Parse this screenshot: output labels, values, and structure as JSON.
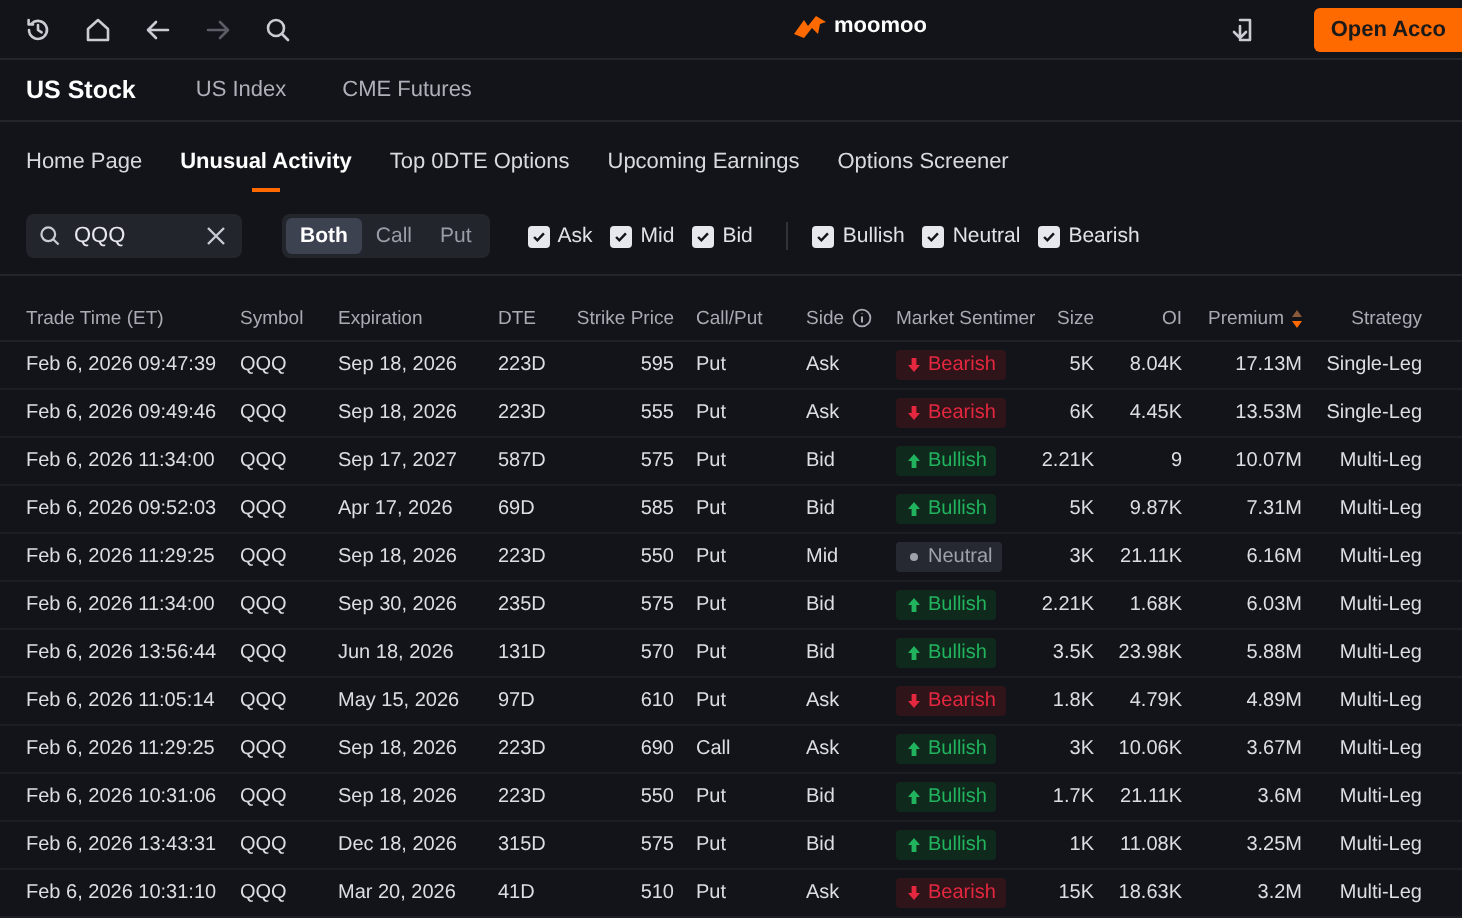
{
  "top_bar": {
    "logo": "moomoo",
    "open_account_button": "Open Acco"
  },
  "market_tabs": [
    {
      "label": "US Stock",
      "selected": true
    },
    {
      "label": "US Index",
      "selected": false
    },
    {
      "label": "CME Futures",
      "selected": false
    }
  ],
  "sub_tabs": [
    {
      "label": "Home Page",
      "selected": false
    },
    {
      "label": "Unusual Activity",
      "selected": true
    },
    {
      "label": "Top 0DTE Options",
      "selected": false
    },
    {
      "label": "Upcoming Earnings",
      "selected": false
    },
    {
      "label": "Options Screener",
      "selected": false
    }
  ],
  "search": {
    "value": "QQQ"
  },
  "type_segment": [
    {
      "label": "Both",
      "selected": true
    },
    {
      "label": "Call",
      "selected": false
    },
    {
      "label": "Put",
      "selected": false
    }
  ],
  "side_filters": [
    {
      "label": "Ask",
      "checked": true
    },
    {
      "label": "Mid",
      "checked": true
    },
    {
      "label": "Bid",
      "checked": true
    }
  ],
  "sentiment_filters": [
    {
      "label": "Bullish",
      "checked": true
    },
    {
      "label": "Neutral",
      "checked": true
    },
    {
      "label": "Bearish",
      "checked": true
    }
  ],
  "table": {
    "columns": [
      "Trade Time (ET)",
      "Symbol",
      "Expiration",
      "DTE",
      "Strike Price",
      "Call/Put",
      "Side",
      "Market Sentimer",
      "Size",
      "OI",
      "Premium",
      "Strategy"
    ],
    "rows": [
      {
        "time": "Feb 6, 2026 09:47:39",
        "symbol": "QQQ",
        "expiration": "Sep 18, 2026",
        "dte": "223D",
        "strike": "595",
        "type": "Put",
        "side": "Ask",
        "sentiment": {
          "kind": "bearish",
          "label": "Bearish"
        },
        "size": "5K",
        "oi": "8.04K",
        "premium": "17.13M",
        "strategy": "Single-Leg"
      },
      {
        "time": "Feb 6, 2026 09:49:46",
        "symbol": "QQQ",
        "expiration": "Sep 18, 2026",
        "dte": "223D",
        "strike": "555",
        "type": "Put",
        "side": "Ask",
        "sentiment": {
          "kind": "bearish",
          "label": "Bearish"
        },
        "size": "6K",
        "oi": "4.45K",
        "premium": "13.53M",
        "strategy": "Single-Leg"
      },
      {
        "time": "Feb 6, 2026 11:34:00",
        "symbol": "QQQ",
        "expiration": "Sep 17, 2027",
        "dte": "587D",
        "strike": "575",
        "type": "Put",
        "side": "Bid",
        "sentiment": {
          "kind": "bullish",
          "label": "Bullish"
        },
        "size": "2.21K",
        "oi": "9",
        "premium": "10.07M",
        "strategy": "Multi-Leg"
      },
      {
        "time": "Feb 6, 2026 09:52:03",
        "symbol": "QQQ",
        "expiration": "Apr 17, 2026",
        "dte": "69D",
        "strike": "585",
        "type": "Put",
        "side": "Bid",
        "sentiment": {
          "kind": "bullish",
          "label": "Bullish"
        },
        "size": "5K",
        "oi": "9.87K",
        "premium": "7.31M",
        "strategy": "Multi-Leg"
      },
      {
        "time": "Feb 6, 2026 11:29:25",
        "symbol": "QQQ",
        "expiration": "Sep 18, 2026",
        "dte": "223D",
        "strike": "550",
        "type": "Put",
        "side": "Mid",
        "sentiment": {
          "kind": "neutral",
          "label": "Neutral"
        },
        "size": "3K",
        "oi": "21.11K",
        "premium": "6.16M",
        "strategy": "Multi-Leg"
      },
      {
        "time": "Feb 6, 2026 11:34:00",
        "symbol": "QQQ",
        "expiration": "Sep 30, 2026",
        "dte": "235D",
        "strike": "575",
        "type": "Put",
        "side": "Bid",
        "sentiment": {
          "kind": "bullish",
          "label": "Bullish"
        },
        "size": "2.21K",
        "oi": "1.68K",
        "premium": "6.03M",
        "strategy": "Multi-Leg"
      },
      {
        "time": "Feb 6, 2026 13:56:44",
        "symbol": "QQQ",
        "expiration": "Jun 18, 2026",
        "dte": "131D",
        "strike": "570",
        "type": "Put",
        "side": "Bid",
        "sentiment": {
          "kind": "bullish",
          "label": "Bullish"
        },
        "size": "3.5K",
        "oi": "23.98K",
        "premium": "5.88M",
        "strategy": "Multi-Leg"
      },
      {
        "time": "Feb 6, 2026 11:05:14",
        "symbol": "QQQ",
        "expiration": "May 15, 2026",
        "dte": "97D",
        "strike": "610",
        "type": "Put",
        "side": "Ask",
        "sentiment": {
          "kind": "bearish",
          "label": "Bearish"
        },
        "size": "1.8K",
        "oi": "4.79K",
        "premium": "4.89M",
        "strategy": "Multi-Leg"
      },
      {
        "time": "Feb 6, 2026 11:29:25",
        "symbol": "QQQ",
        "expiration": "Sep 18, 2026",
        "dte": "223D",
        "strike": "690",
        "type": "Call",
        "side": "Ask",
        "sentiment": {
          "kind": "bullish",
          "label": "Bullish"
        },
        "size": "3K",
        "oi": "10.06K",
        "premium": "3.67M",
        "strategy": "Multi-Leg"
      },
      {
        "time": "Feb 6, 2026 10:31:06",
        "symbol": "QQQ",
        "expiration": "Sep 18, 2026",
        "dte": "223D",
        "strike": "550",
        "type": "Put",
        "side": "Bid",
        "sentiment": {
          "kind": "bullish",
          "label": "Bullish"
        },
        "size": "1.7K",
        "oi": "21.11K",
        "premium": "3.6M",
        "strategy": "Multi-Leg"
      },
      {
        "time": "Feb 6, 2026 13:43:31",
        "symbol": "QQQ",
        "expiration": "Dec 18, 2026",
        "dte": "315D",
        "strike": "575",
        "type": "Put",
        "side": "Bid",
        "sentiment": {
          "kind": "bullish",
          "label": "Bullish"
        },
        "size": "1K",
        "oi": "11.08K",
        "premium": "3.25M",
        "strategy": "Multi-Leg"
      },
      {
        "time": "Feb 6, 2026 10:31:10",
        "symbol": "QQQ",
        "expiration": "Mar 20, 2026",
        "dte": "41D",
        "strike": "510",
        "type": "Put",
        "side": "Ask",
        "sentiment": {
          "kind": "bearish",
          "label": "Bearish"
        },
        "size": "15K",
        "oi": "18.63K",
        "premium": "3.2M",
        "strategy": "Multi-Leg"
      }
    ]
  }
}
